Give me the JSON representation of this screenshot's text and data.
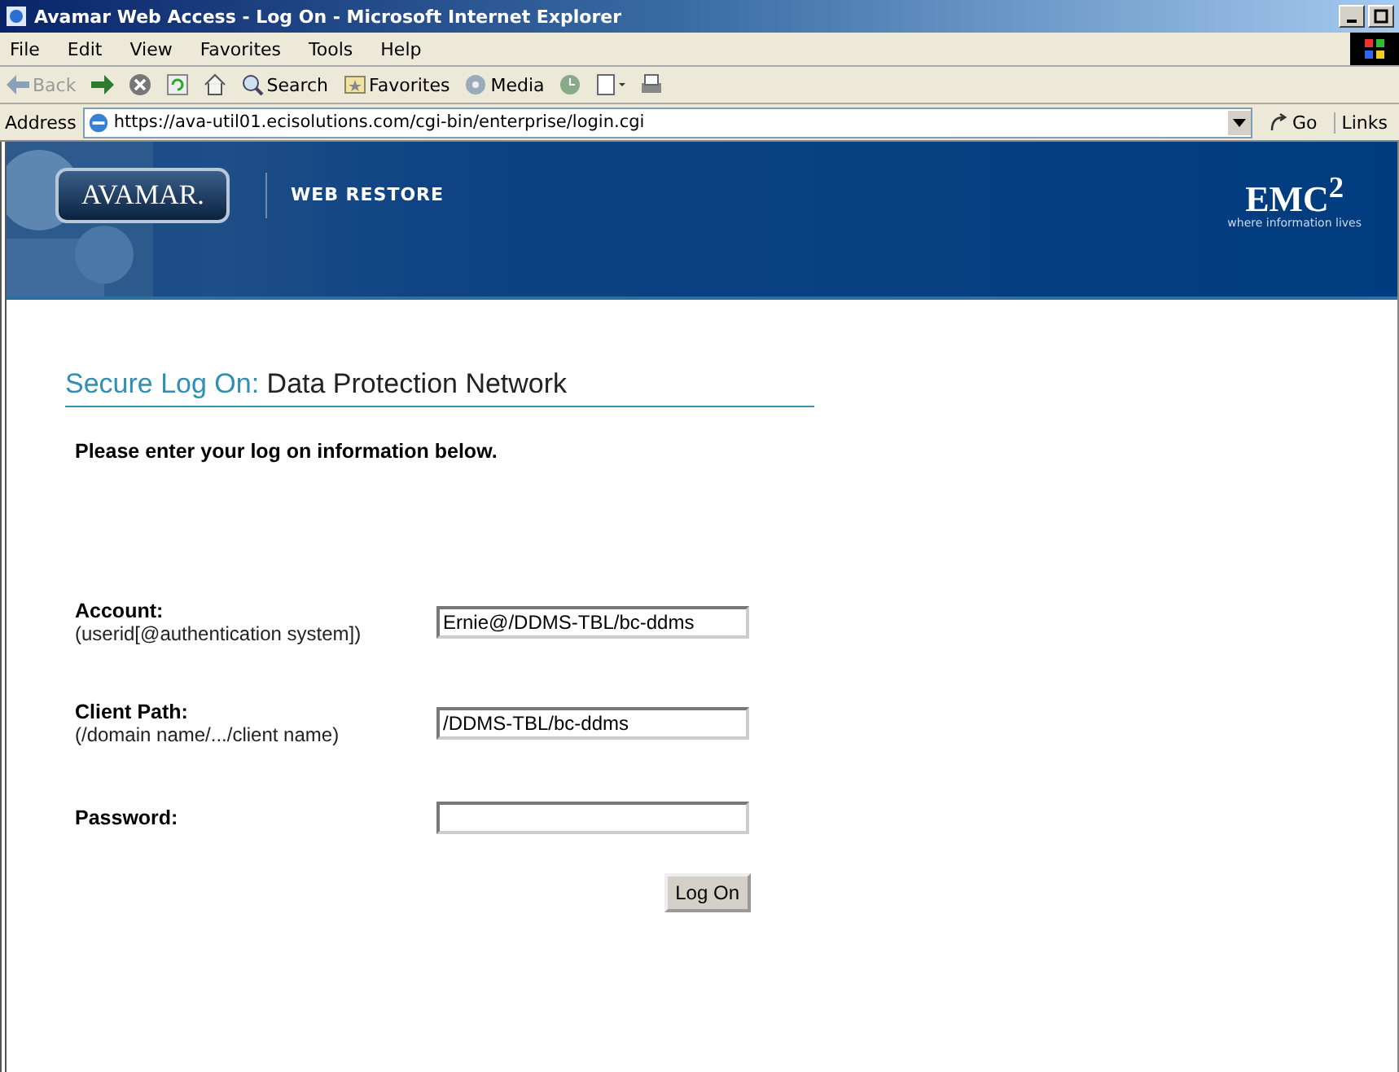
{
  "window": {
    "title": "Avamar Web Access - Log On - Microsoft Internet Explorer"
  },
  "menu": [
    "File",
    "Edit",
    "View",
    "Favorites",
    "Tools",
    "Help"
  ],
  "toolbar": [
    {
      "kind": "back",
      "label": "Back"
    },
    {
      "kind": "forward"
    },
    {
      "kind": "stop"
    },
    {
      "kind": "refresh"
    },
    {
      "kind": "home"
    },
    {
      "kind": "search",
      "label": "Search"
    },
    {
      "kind": "favorites",
      "label": "Favorites"
    },
    {
      "kind": "media",
      "label": "Media"
    },
    {
      "kind": "history"
    },
    {
      "kind": "mail"
    },
    {
      "kind": "print"
    }
  ],
  "address": {
    "label": "Address",
    "value": "https://ava-util01.ecisolutions.com/cgi-bin/enterprise/login.cgi",
    "go": "Go",
    "links": "Links"
  },
  "banner": {
    "logo": "AVAMAR.",
    "product": "WEB RESTORE",
    "brand": "EMC$^{2}$",
    "tagline": "where information lives"
  },
  "heading": {
    "prefix": "Secure Log On:",
    "title": "Data Protection Network"
  },
  "intro": "Please enter your log on information below.",
  "fields": [
    {
      "label": "Account:",
      "hint": "(userid[@authentication system])",
      "value": "Ernie@/DDMS-TBL/bc-ddms"
    },
    {
      "label": "Client Path:",
      "hint": "(/domain name/.../client name)",
      "value": "/DDMS-TBL/bc-ddms"
    },
    {
      "label": "Password:"
    }
  ],
  "submit": "Log On"
}
